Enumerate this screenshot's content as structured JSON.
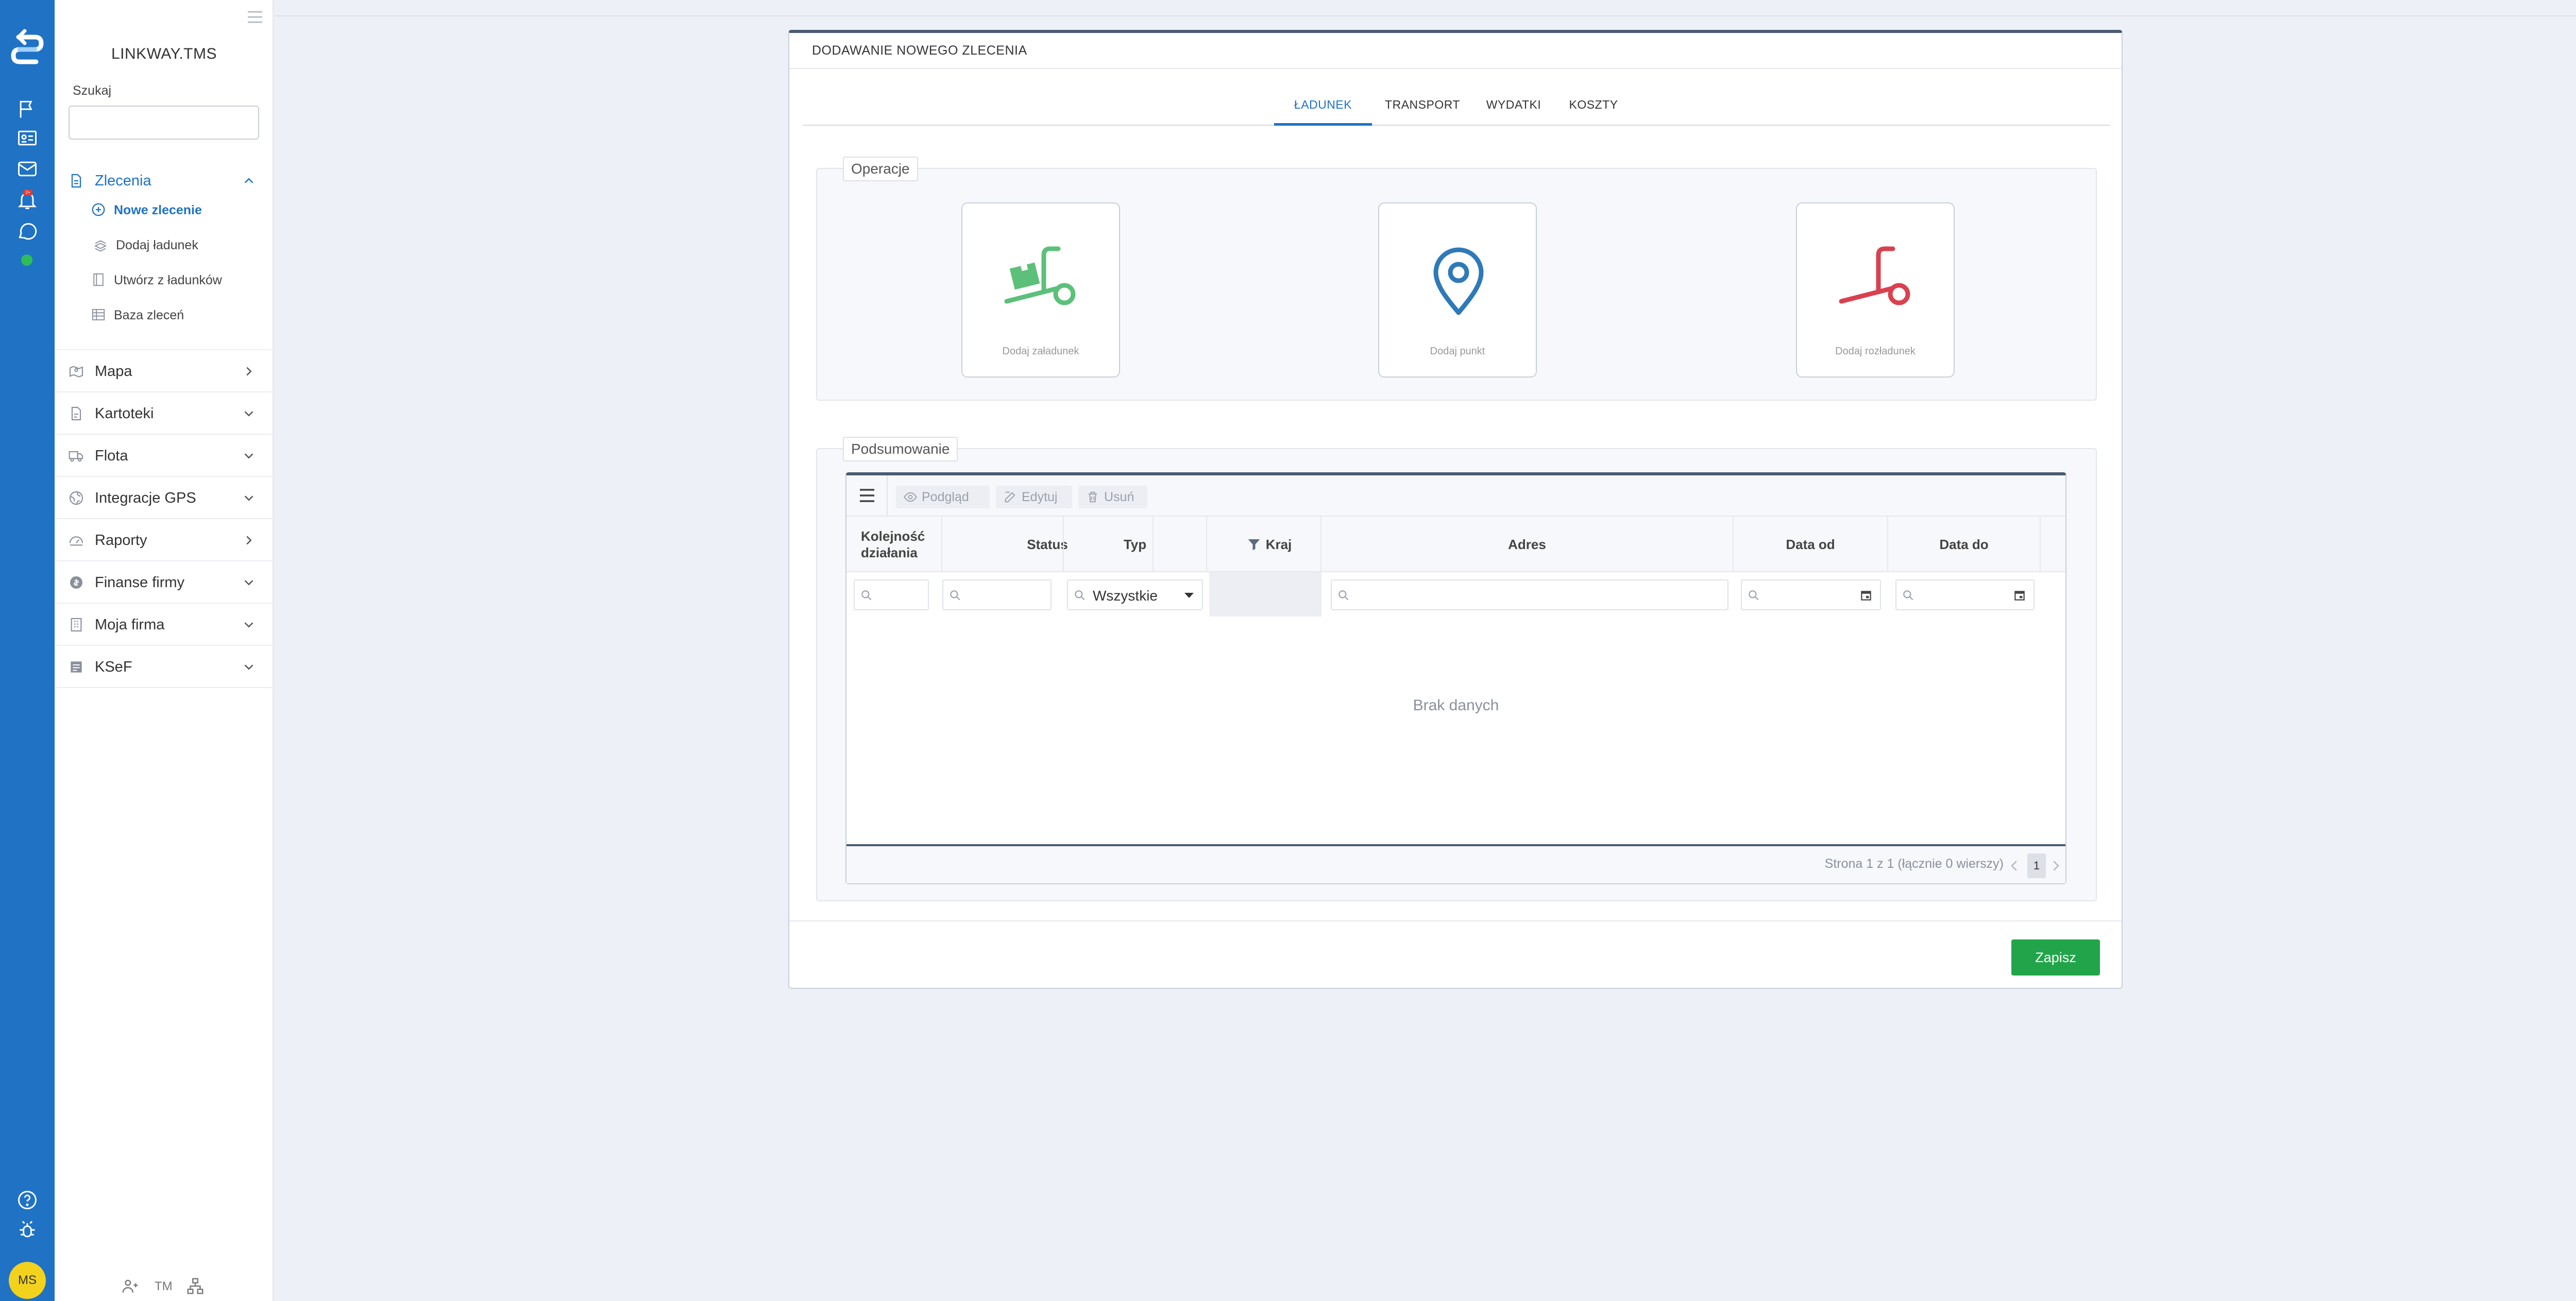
{
  "rail": {
    "avatar_initials": "MS",
    "notification_badge": "2+",
    "online_color": "#2ebd59",
    "accent": "#1f72c4",
    "icons": [
      "logo-icon",
      "flag-icon",
      "id-card-icon",
      "mail-icon",
      "bell-icon",
      "chat-icon",
      "help-icon",
      "bug-icon"
    ]
  },
  "sidebar": {
    "brand": "LINKWAY.TMS",
    "search_label": "Szukaj",
    "search_value": "",
    "groups": [
      {
        "label": "Zlecenia",
        "icon": "document-icon",
        "expanded": true,
        "items": [
          {
            "label": "Nowe zlecenie",
            "icon": "plus-circle-icon"
          },
          {
            "label": "Dodaj ładunek",
            "icon": "boxes-icon"
          },
          {
            "label": "Utwórz z ładunków",
            "icon": "book-icon"
          },
          {
            "label": "Baza zleceń",
            "icon": "table-icon"
          }
        ]
      },
      {
        "label": "Mapa",
        "icon": "map-icon"
      },
      {
        "label": "Kartoteki",
        "icon": "file-icon"
      },
      {
        "label": "Flota",
        "icon": "truck-icon"
      },
      {
        "label": "Integracje GPS",
        "icon": "globe-icon"
      },
      {
        "label": "Raporty",
        "icon": "gauge-icon"
      },
      {
        "label": "Finanse firmy",
        "icon": "coin-icon"
      },
      {
        "label": "Moja firma",
        "icon": "building-icon"
      },
      {
        "label": "KSeF",
        "icon": "invoice-icon"
      }
    ],
    "footer_tm": "TM"
  },
  "panel": {
    "title": "DODAWANIE NOWEGO ZLECENIA",
    "tabs": [
      "ŁADUNEK",
      "TRANSPORT",
      "WYDATKI",
      "KOSZTY"
    ],
    "active_tab": 0,
    "operations": {
      "legend": "Operacje",
      "cards": [
        {
          "label": "Dodaj załadunek",
          "icon": "loading-cart-icon",
          "color": "#5cc07a"
        },
        {
          "label": "Dodaj punkt",
          "icon": "map-pin-icon",
          "color": "#2e7ab8"
        },
        {
          "label": "Dodaj rozładunek",
          "icon": "unloading-cart-icon",
          "color": "#d9414f"
        }
      ]
    },
    "summary": {
      "legend": "Podsumowanie",
      "toolbar": {
        "view": "Podgląd",
        "edit": "Edytuj",
        "delete": "Usuń"
      },
      "columns": [
        "Kolejność działania",
        "Status",
        "Typ",
        "Kraj",
        "Adres",
        "Data od",
        "Data do"
      ],
      "type_filter": "Wszystkie",
      "empty_text": "Brak danych",
      "pager_text": "Strona 1 z 1 (łącznie 0 wierszy)",
      "page": "1"
    },
    "save_label": "Zapisz"
  }
}
